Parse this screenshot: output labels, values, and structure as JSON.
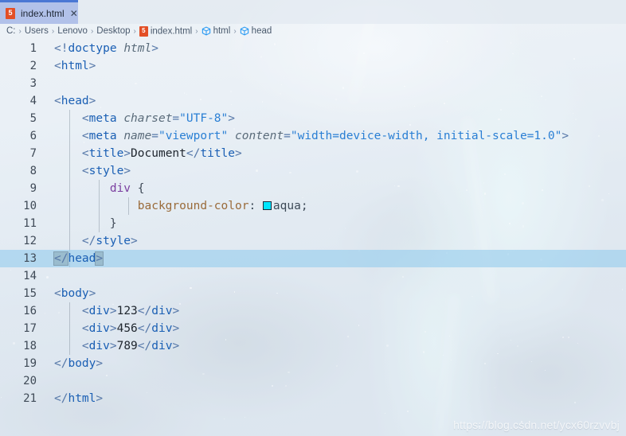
{
  "window": {
    "accent_color": "#4a77d4",
    "tab_background": "#9cb0e4"
  },
  "tab": {
    "icon": "html5-file-icon",
    "icon_glyph": "5",
    "label": "index.html",
    "close_glyph": "✕"
  },
  "breadcrumb": {
    "separator": "›",
    "items": [
      {
        "label": "C:",
        "icon": ""
      },
      {
        "label": "Users",
        "icon": ""
      },
      {
        "label": "Lenovo",
        "icon": ""
      },
      {
        "label": "Desktop",
        "icon": ""
      },
      {
        "label": "index.html",
        "icon": "html5-file-icon"
      },
      {
        "label": "html",
        "icon": "symbol-cube-icon"
      },
      {
        "label": "head",
        "icon": "symbol-cube-icon"
      }
    ]
  },
  "editor": {
    "active_line": 13,
    "color_swatch_hex": "#00e5ff",
    "lines": [
      {
        "n": "1",
        "html": "<span class=\"punct\">&lt;!</span><span class=\"tag\">doctype</span> <span class=\"attr\">html</span><span class=\"punct\">&gt;</span>"
      },
      {
        "n": "2",
        "html": "<span class=\"punct\">&lt;</span><span class=\"tag\">html</span><span class=\"punct\">&gt;</span>"
      },
      {
        "n": "3",
        "html": ""
      },
      {
        "n": "4",
        "html": "<span class=\"punct\">&lt;</span><span class=\"tag\">head</span><span class=\"punct\">&gt;</span>"
      },
      {
        "n": "5",
        "html": "    <span class=\"punct\">&lt;</span><span class=\"tag\">meta</span> <span class=\"attr\">charset</span><span class=\"punct\">=</span><span class=\"str\">\"UTF-8\"</span><span class=\"punct\">&gt;</span>"
      },
      {
        "n": "6",
        "html": "    <span class=\"punct\">&lt;</span><span class=\"tag\">meta</span> <span class=\"attr\">name</span><span class=\"punct\">=</span><span class=\"str\">\"viewport\"</span> <span class=\"attr\">content</span><span class=\"punct\">=</span><span class=\"str\">\"width=device-width, initial-scale=1.0\"</span><span class=\"punct\">&gt;</span>"
      },
      {
        "n": "7",
        "html": "    <span class=\"punct\">&lt;</span><span class=\"tag\">title</span><span class=\"punct\">&gt;</span><span class=\"text\">Document</span><span class=\"punct\">&lt;/</span><span class=\"tag\">title</span><span class=\"punct\">&gt;</span>"
      },
      {
        "n": "8",
        "html": "    <span class=\"punct\">&lt;</span><span class=\"tag\">style</span><span class=\"punct\">&gt;</span>"
      },
      {
        "n": "9",
        "html": "        <span class=\"sel\">div</span> <span class=\"brace\">{</span>"
      },
      {
        "n": "10",
        "html": "            <span class=\"prop\">background-color</span><span class=\"val\">:</span> <span class=\"swatch-slot\"></span><span class=\"val\">aqua;</span>"
      },
      {
        "n": "11",
        "html": "        <span class=\"brace\">}</span>"
      },
      {
        "n": "12",
        "html": "    <span class=\"punct\">&lt;/</span><span class=\"tag\">style</span><span class=\"punct\">&gt;</span>"
      },
      {
        "n": "13",
        "html": "<span class=\"punct bracket-match\">&lt;/</span><span class=\"tag\">head</span><span class=\"punct bracket-match\">&gt;</span>"
      },
      {
        "n": "14",
        "html": ""
      },
      {
        "n": "15",
        "html": "<span class=\"punct\">&lt;</span><span class=\"tag\">body</span><span class=\"punct\">&gt;</span>"
      },
      {
        "n": "16",
        "html": "    <span class=\"punct\">&lt;</span><span class=\"tag\">div</span><span class=\"punct\">&gt;</span><span class=\"text\">123</span><span class=\"punct\">&lt;/</span><span class=\"tag\">div</span><span class=\"punct\">&gt;</span>"
      },
      {
        "n": "17",
        "html": "    <span class=\"punct\">&lt;</span><span class=\"tag\">div</span><span class=\"punct\">&gt;</span><span class=\"text\">456</span><span class=\"punct\">&lt;/</span><span class=\"tag\">div</span><span class=\"punct\">&gt;</span>"
      },
      {
        "n": "18",
        "html": "    <span class=\"punct\">&lt;</span><span class=\"tag\">div</span><span class=\"punct\">&gt;</span><span class=\"text\">789</span><span class=\"punct\">&lt;/</span><span class=\"tag\">div</span><span class=\"punct\">&gt;</span>"
      },
      {
        "n": "19",
        "html": "<span class=\"punct\">&lt;/</span><span class=\"tag\">body</span><span class=\"punct\">&gt;</span>"
      },
      {
        "n": "20",
        "html": ""
      },
      {
        "n": "21",
        "html": "<span class=\"punct\">&lt;/</span><span class=\"tag\">html</span><span class=\"punct\">&gt;</span>"
      }
    ],
    "plain_text": [
      "<!doctype html>",
      "<html>",
      "",
      "<head>",
      "    <meta charset=\"UTF-8\">",
      "    <meta name=\"viewport\" content=\"width=device-width, initial-scale=1.0\">",
      "    <title>Document</title>",
      "    <style>",
      "        div {",
      "            background-color: aqua;",
      "        }",
      "    </style>",
      "</head>",
      "",
      "<body>",
      "    <div>123</div>",
      "    <div>456</div>",
      "    <div>789</div>",
      "</body>",
      "",
      "</html>"
    ]
  },
  "watermark": {
    "text": "https://blog.csdn.net/ycx60rzvvbj"
  }
}
